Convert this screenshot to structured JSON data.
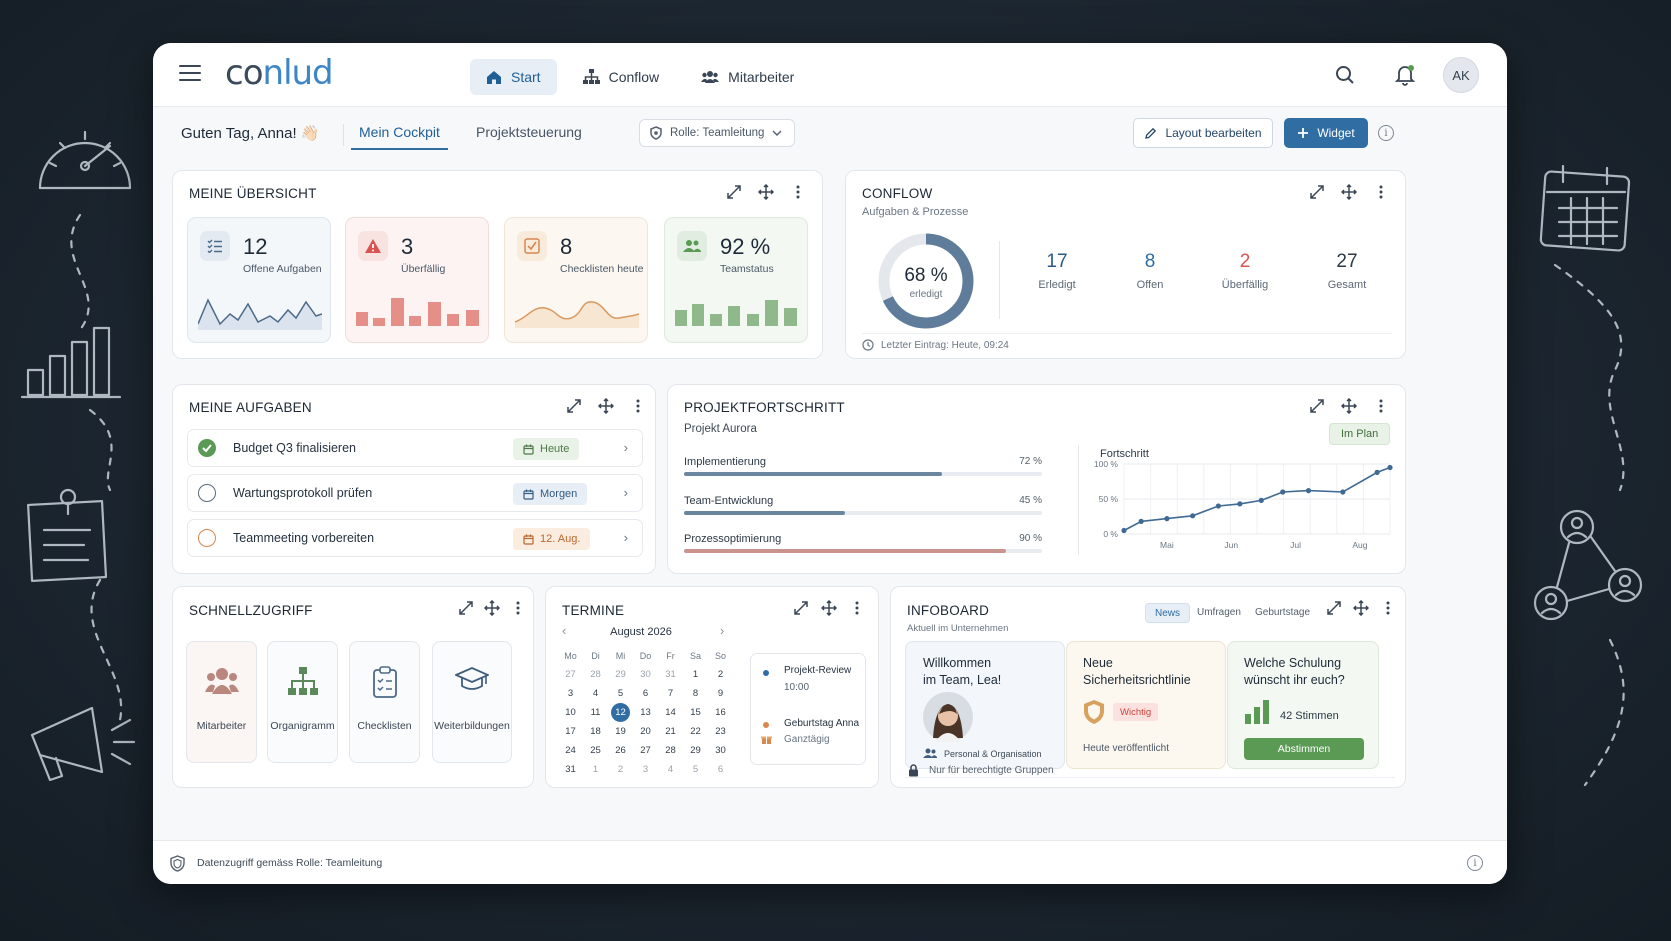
{
  "topbar": {
    "logo_a": "co",
    "logo_b": "n",
    "logo_c": "lud",
    "nav": [
      {
        "label": "Start"
      },
      {
        "label": "Conflow"
      },
      {
        "label": "Mitarbeiter"
      }
    ],
    "avatar": "AK"
  },
  "subbar": {
    "greeting": "Guten Tag, Anna! 👋🏻",
    "tabs": [
      {
        "label": "Mein Cockpit"
      },
      {
        "label": "Projektsteuerung"
      }
    ],
    "role": "Rolle: Teamleitung",
    "edit_layout": "Layout bearbeiten",
    "add_widget": "Widget"
  },
  "overview": {
    "title": "MEINE ÜBERSICHT",
    "kpis": [
      {
        "value": "12",
        "label": "Offene Aufgaben"
      },
      {
        "value": "3",
        "label": "Überfällig"
      },
      {
        "value": "8",
        "label": "Checklisten heute"
      },
      {
        "value": "92 %",
        "label": "Teamstatus"
      }
    ]
  },
  "conflow": {
    "title": "CONFLOW",
    "subtitle": "Aufgaben & Prozesse",
    "donut_value": "68 %",
    "donut_fraction": 0.68,
    "donut_label": "erledigt",
    "stats": [
      {
        "value": "17",
        "label": "Erledigt"
      },
      {
        "value": "8",
        "label": "Offen"
      },
      {
        "value": "2",
        "label": "Überfällig"
      },
      {
        "value": "27",
        "label": "Gesamt"
      }
    ],
    "last_entry": "Letzter Eintrag: Heute, 09:24"
  },
  "tasks": {
    "title": "MEINE AUFGABEN",
    "items": [
      {
        "title": "Budget Q3 finalisieren",
        "due": "Heute"
      },
      {
        "title": "Wartungsprotokoll prüfen",
        "due": "Morgen"
      },
      {
        "title": "Teammeeting vorbereiten",
        "due": "12. Aug."
      }
    ]
  },
  "progress": {
    "title": "PROJEKTFORTSCHRITT",
    "subtitle": "Projekt Aurora",
    "badge": "Im Plan",
    "rows": [
      {
        "label": "Implementierung",
        "value": "72 %",
        "fraction": 0.72
      },
      {
        "label": "Team-Entwicklung",
        "value": "45 %",
        "fraction": 0.45
      },
      {
        "label": "Prozessoptimierung",
        "value": "90 %",
        "fraction": 0.9
      }
    ],
    "chart_label": "Fortschritt"
  },
  "chart_data": {
    "type": "line",
    "title": "Fortschritt",
    "x_tick_labels": [
      "Mai",
      "Jun",
      "Jul",
      "Aug"
    ],
    "y_tick_labels": [
      "100 %",
      "50 %",
      "0 %"
    ],
    "ylim": [
      0,
      100
    ],
    "grid": true,
    "x": [
      0,
      0.4,
      1.0,
      1.6,
      2.2,
      2.7,
      3.2,
      3.7,
      4.3,
      5.1,
      5.9,
      6.2
    ],
    "values": [
      5,
      18,
      22,
      26,
      40,
      43,
      48,
      60,
      62,
      60,
      88,
      95
    ]
  },
  "quick": {
    "title": "SCHNELLZUGRIFF",
    "items": [
      {
        "label": "Mitarbeiter"
      },
      {
        "label": "Organigramm"
      },
      {
        "label": "Checklisten"
      },
      {
        "label": "Weiterbildungen"
      }
    ]
  },
  "dates": {
    "title": "TERMINE",
    "month": "August 2026",
    "weekdays": [
      "Mo",
      "Di",
      "Mi",
      "Do",
      "Fr",
      "Sa",
      "So"
    ],
    "weeks": [
      [
        "27",
        "28",
        "29",
        "30",
        "31",
        "1",
        "2"
      ],
      [
        "3",
        "4",
        "5",
        "6",
        "7",
        "8",
        "9"
      ],
      [
        "10",
        "11",
        "12",
        "13",
        "14",
        "15",
        "16"
      ],
      [
        "17",
        "18",
        "19",
        "20",
        "21",
        "22",
        "23"
      ],
      [
        "24",
        "25",
        "26",
        "27",
        "28",
        "29",
        "30"
      ],
      [
        "31",
        "1",
        "2",
        "3",
        "4",
        "5",
        "6"
      ]
    ],
    "events": [
      {
        "title": "Projekt-Review",
        "time": "10:00"
      },
      {
        "title": "Geburtstag Anna",
        "time": "Ganztägig"
      }
    ]
  },
  "infoboard": {
    "title": "INFOBOARD",
    "subtitle": "Aktuell im Unternehmen",
    "tabs": [
      {
        "label": "News"
      },
      {
        "label": "Umfragen"
      },
      {
        "label": "Geburtstage"
      }
    ],
    "welcome_line1": "Willkommen",
    "welcome_line2": "im Team, Lea!",
    "welcome_dept": "Personal & Organisation",
    "policy_line1": "Neue",
    "policy_line2": "Sicherheitsrichtlinie",
    "policy_badge": "Wichtig",
    "policy_date": "Heute veröffentlicht",
    "survey_line1": "Welche Schulung",
    "survey_line2": "wünscht ihr euch?",
    "survey_votes": "42 Stimmen",
    "survey_button": "Abstimmen",
    "restricted": "Nur für berechtigte Gruppen"
  },
  "footer": {
    "text": "Datenzugriff gemäss Rolle: Teamleitung"
  },
  "colors": {
    "primary": "#2f6da3",
    "danger": "#d9534f",
    "success": "#5a9a54",
    "warning": "#d98850"
  }
}
